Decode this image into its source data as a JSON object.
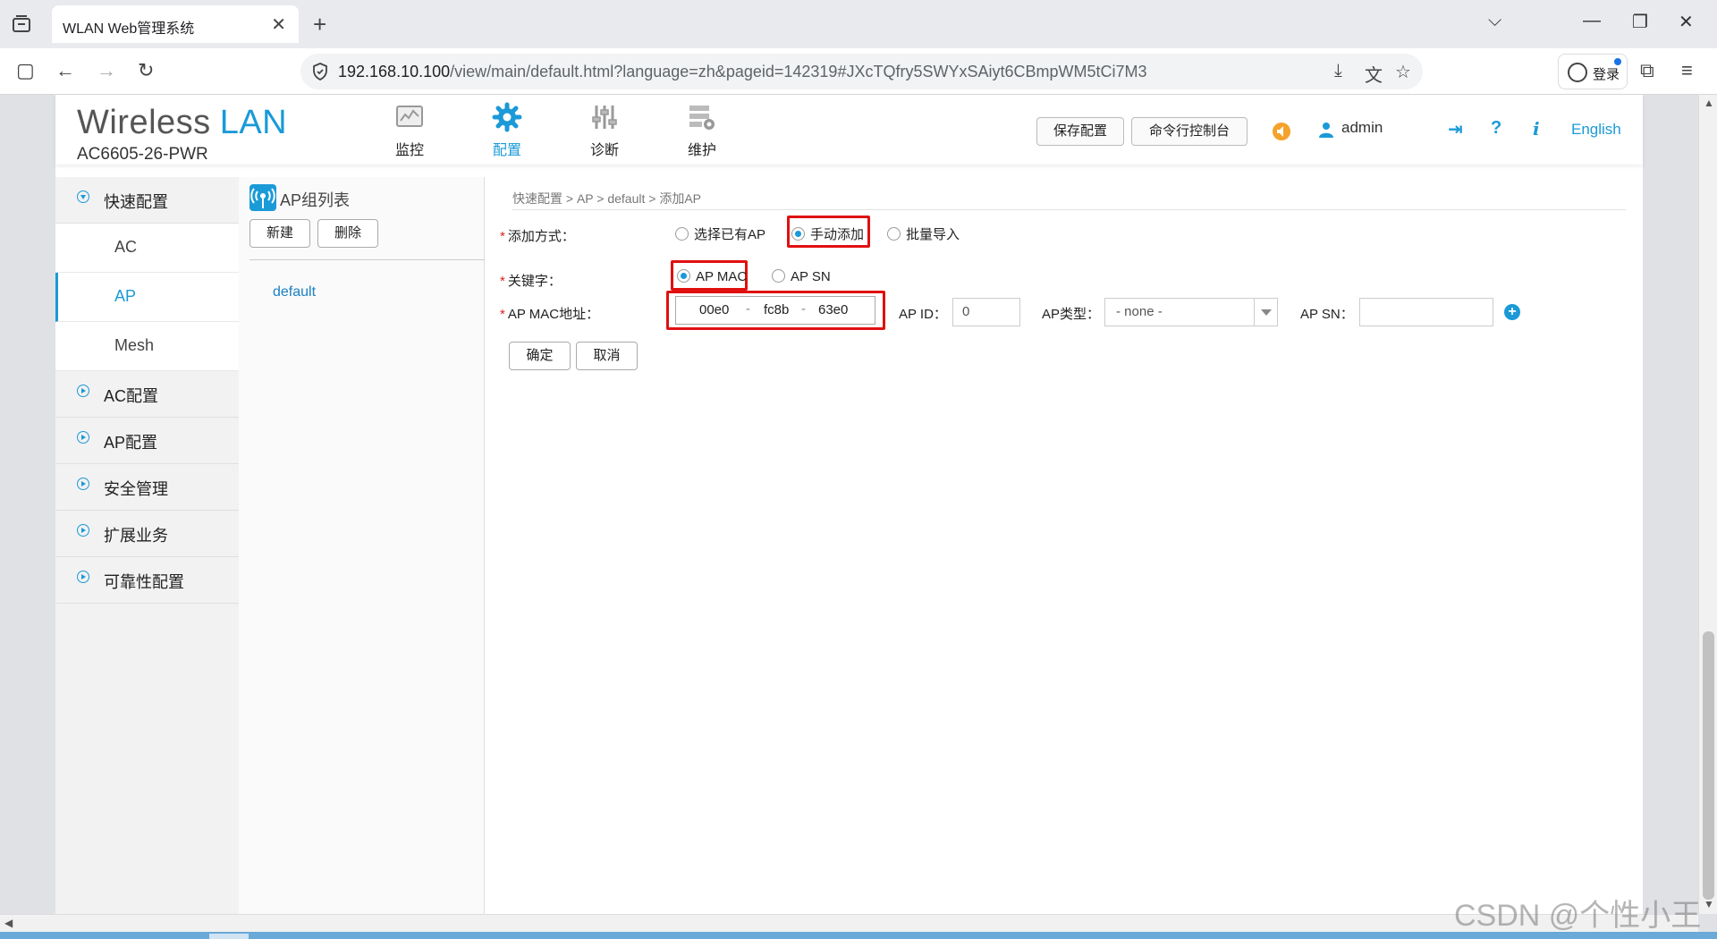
{
  "browser": {
    "tab_title": "WLAN Web管理系统",
    "url_host": "192.168.10.100",
    "url_path": "/view/main/default.html?language=zh&pageid=142319#JXcTQfry5SWYxSAiyt6CBmpWM5tCi7M3",
    "login_label": "登录"
  },
  "header": {
    "brand_main": "Wireless",
    "brand_accent": "LAN",
    "model": "AC6605-26-PWR",
    "nav": [
      {
        "label": "监控",
        "icon": "monitor-icon"
      },
      {
        "label": "配置",
        "icon": "gear-icon",
        "active": true
      },
      {
        "label": "诊断",
        "icon": "sliders-icon"
      },
      {
        "label": "维护",
        "icon": "server-gear-icon"
      }
    ],
    "save_config": "保存配置",
    "cli_console": "命令行控制台",
    "user": "admin",
    "language": "English"
  },
  "leftmenu": {
    "quick_config": "快速配置",
    "subs": [
      "AC",
      "AP",
      "Mesh"
    ],
    "active_sub": "AP",
    "items": [
      "AC配置",
      "AP配置",
      "安全管理",
      "扩展业务",
      "可靠性配置"
    ]
  },
  "group_panel": {
    "title": "AP组列表",
    "new_btn": "新建",
    "delete_btn": "删除",
    "groups": [
      "default"
    ]
  },
  "form": {
    "breadcrumb": "快速配置 > AP > default > 添加AP",
    "add_method_label": "添加方式：",
    "add_method_options": [
      "选择已有AP",
      "手动添加",
      "批量导入"
    ],
    "add_method_selected": "手动添加",
    "key_label": "关键字：",
    "key_options": [
      "AP MAC",
      "AP SN"
    ],
    "key_selected": "AP MAC",
    "mac_label": "AP MAC地址：",
    "mac_parts": [
      "00e0",
      "fc8b",
      "63e0"
    ],
    "mac_sep": "-",
    "apid_label": "AP ID：",
    "apid_value": "0",
    "aptype_label": "AP类型：",
    "aptype_value": "- none -",
    "apsn_label": "AP SN：",
    "apsn_value": "",
    "ok_btn": "确定",
    "cancel_btn": "取消"
  },
  "watermark": "CSDN @个性小王",
  "colors": {
    "accent": "#1a9ad7",
    "highlight": "#e01010"
  }
}
